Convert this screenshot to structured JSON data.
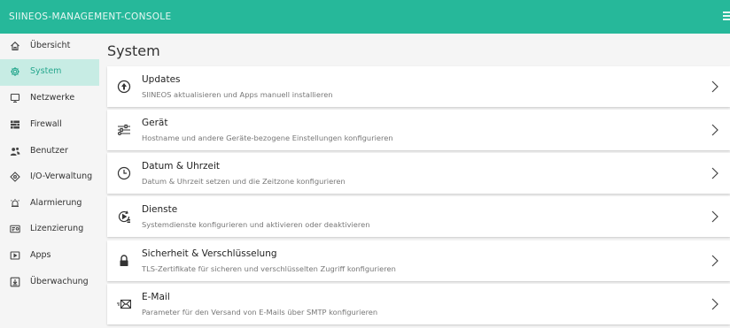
{
  "app": {
    "title": "SIINEOS-MANAGEMENT-CONSOLE"
  },
  "sidebar": {
    "items": [
      {
        "label": "Übersicht",
        "icon": "home-icon",
        "active": false
      },
      {
        "label": "System",
        "icon": "gear-icon",
        "active": true
      },
      {
        "label": "Netzwerke",
        "icon": "monitor-icon",
        "active": false
      },
      {
        "label": "Firewall",
        "icon": "firewall-icon",
        "active": false
      },
      {
        "label": "Benutzer",
        "icon": "users-icon",
        "active": false
      },
      {
        "label": "I/O-Verwaltung",
        "icon": "io-icon",
        "active": false
      },
      {
        "label": "Alarmierung",
        "icon": "alarm-icon",
        "active": false
      },
      {
        "label": "Lizenzierung",
        "icon": "license-icon",
        "active": false
      },
      {
        "label": "Apps",
        "icon": "apps-icon",
        "active": false
      },
      {
        "label": "Überwachung",
        "icon": "monitoring-icon",
        "active": false
      }
    ]
  },
  "main": {
    "title": "System",
    "cards": [
      {
        "title": "Updates",
        "description": "SIINEOS aktualisieren und Apps manuell installieren",
        "icon": "update-icon"
      },
      {
        "title": "Gerät",
        "description": "Hostname und andere Geräte-bezogene Einstellungen konfigurieren",
        "icon": "sliders-icon"
      },
      {
        "title": "Datum & Uhrzeit",
        "description": "Datum & Uhrzeit setzen und die Zeitzone konfigurieren",
        "icon": "clock-icon"
      },
      {
        "title": "Dienste",
        "description": "Systemdienste konfigurieren und aktivieren oder deaktivieren",
        "icon": "services-icon"
      },
      {
        "title": "Sicherheit & Verschlüsselung",
        "description": "TLS-Zertifikate für sicheren und verschlüsselten Zugriff konfigurieren",
        "icon": "lock-icon"
      },
      {
        "title": "E-Mail",
        "description": "Parameter für den Versand von E-Mails über SMTP konfigurieren",
        "icon": "mail-icon"
      }
    ]
  },
  "colors": {
    "topbar": "#26b89a",
    "active_nav_bg": "#c7ece4",
    "active_nav_text": "#26a78e"
  }
}
